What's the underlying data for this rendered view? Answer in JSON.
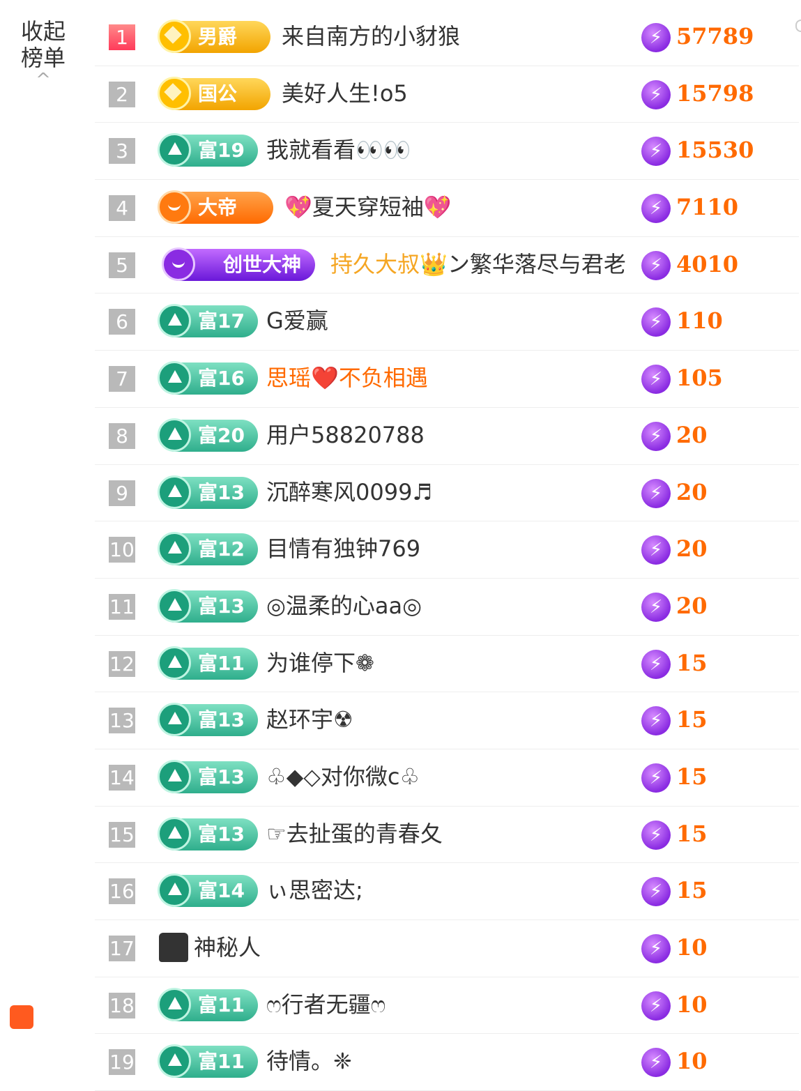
{
  "panel": {
    "collapse_label": "收起\n榜单",
    "collapse_line1": "收起",
    "collapse_line2": "榜单",
    "chevron": "^"
  },
  "rows": [
    {
      "rank": "1",
      "badge": "男爵",
      "badge_style": "gold",
      "name": "来自南方的小豺狼",
      "score": "57789"
    },
    {
      "rank": "2",
      "badge": "国公",
      "badge_style": "gold",
      "name": "美好人生!o5",
      "score": "15798"
    },
    {
      "rank": "3",
      "badge": "富19",
      "badge_style": "green",
      "name": "我就看看👀👀",
      "score": "15530"
    },
    {
      "rank": "4",
      "badge": "大帝",
      "badge_style": "orange",
      "name": "💖夏天穿短袖💖",
      "score": "7110"
    },
    {
      "rank": "5",
      "badge": "创世大神",
      "badge_style": "purple",
      "name_part1": "持久大叔👑",
      "name_part2": "ン繁华落尽与君老",
      "score": "4010"
    },
    {
      "rank": "6",
      "badge": "富17",
      "badge_style": "green",
      "name": "G爱赢",
      "score": "110"
    },
    {
      "rank": "7",
      "badge": "富16",
      "badge_style": "green",
      "name": "思瑶❤️不负相遇",
      "score": "105"
    },
    {
      "rank": "8",
      "badge": "富20",
      "badge_style": "green",
      "name": "用户58820788",
      "score": "20"
    },
    {
      "rank": "9",
      "badge": "富13",
      "badge_style": "green",
      "name": "沉醉寒风0099♬",
      "score": "20"
    },
    {
      "rank": "10",
      "badge": "富12",
      "badge_style": "green",
      "name": "目情有独钟769",
      "score": "20"
    },
    {
      "rank": "11",
      "badge": "富13",
      "badge_style": "green",
      "name": "◎温柔的心aa◎",
      "score": "20"
    },
    {
      "rank": "12",
      "badge": "富11",
      "badge_style": "green",
      "name": "为谁停下❁",
      "score": "15"
    },
    {
      "rank": "13",
      "badge": "富13",
      "badge_style": "green",
      "name": "赵环宇☢",
      "score": "15"
    },
    {
      "rank": "14",
      "badge": "富13",
      "badge_style": "green",
      "name": "♧◆◇对你微c♧",
      "score": "15"
    },
    {
      "rank": "15",
      "badge": "富13",
      "badge_style": "green",
      "name": "☞去扯蛋的青春夂",
      "score": "15"
    },
    {
      "rank": "16",
      "badge": "富14",
      "badge_style": "green",
      "name": "ぃ思密达;",
      "score": "15"
    },
    {
      "rank": "17",
      "badge": "",
      "badge_style": "anon",
      "name": "神秘人",
      "score": "10"
    },
    {
      "rank": "18",
      "badge": "富11",
      "badge_style": "green",
      "name": "ෆ行者无疆ෆ",
      "score": "10"
    },
    {
      "rank": "19",
      "badge": "富11",
      "badge_style": "green",
      "name": "待情。❈",
      "score": "10"
    }
  ],
  "colors": {
    "accent": "#ff6a00",
    "rank_top": "#ff4a66",
    "rank_default": "#b9b9b9",
    "badge_green": "#2fae8c"
  },
  "icons": {
    "score": "lightning-icon",
    "speaker": "speaker-icon"
  }
}
